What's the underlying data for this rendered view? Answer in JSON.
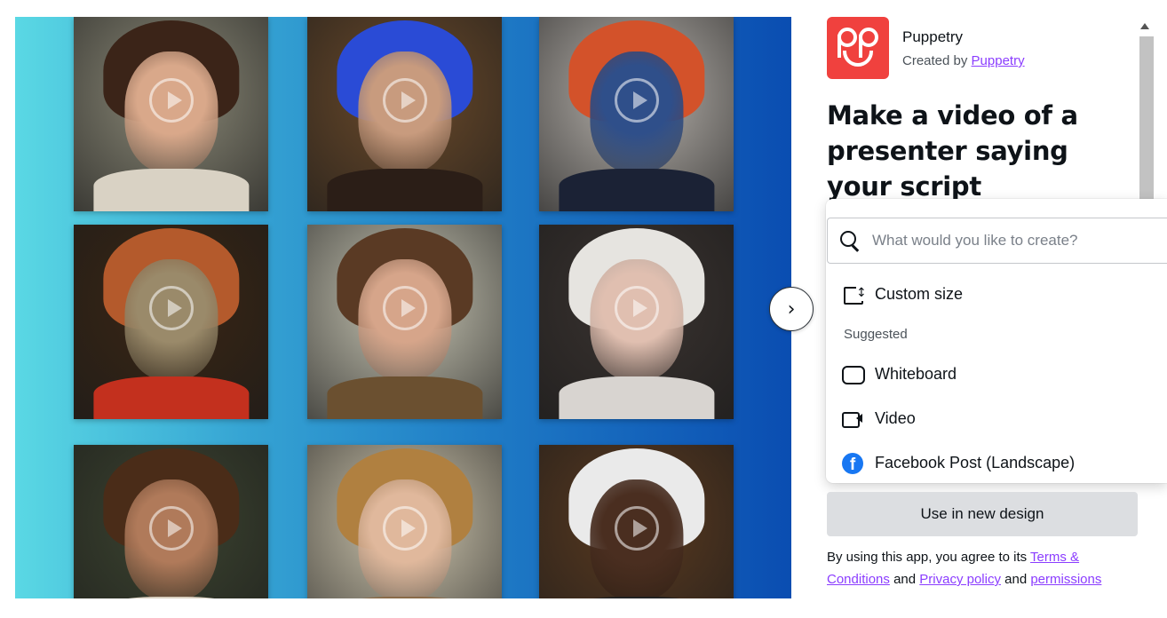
{
  "app": {
    "name": "Puppetry",
    "created_by_prefix": "Created by",
    "created_by_link": "Puppetry",
    "headline": "Make a video of a presenter saying your script",
    "logo_color": "#f0413e"
  },
  "hero": {
    "gradient_colors": [
      "#5ad8e4",
      "#0a4db1"
    ],
    "next_icon": "chevron-right-icon",
    "next_glyph": "›",
    "tiles": [
      {
        "name": "presenter-woman-brown-bob",
        "bg": "#8c8a78",
        "hair": "#3b2418",
        "skin": "#d9a88a",
        "neck": "#d9d2c4"
      },
      {
        "name": "presenter-blue-hair-cyborg",
        "bg": "#6b4a2a",
        "hair": "#2a4bd6",
        "skin": "#c89b7e",
        "neck": "#2b1e17"
      },
      {
        "name": "presenter-blue-skin-redhead",
        "bg": "#b9b4ae",
        "hair": "#d3522a",
        "skin": "#2f4f8a",
        "neck": "#1b2235"
      },
      {
        "name": "presenter-gold-robot",
        "bg": "#3a2614",
        "hair": "#b45a2c",
        "skin": "#9a8a6a",
        "neck": "#c3301e"
      },
      {
        "name": "presenter-woman-long-brown-hair",
        "bg": "#c8c6b4",
        "hair": "#5a3a24",
        "skin": "#d6a58a",
        "neck": "#6b5030"
      },
      {
        "name": "presenter-woman-white-hair",
        "bg": "#3a3330",
        "hair": "#e6e4e0",
        "skin": "#e0bfb0",
        "neck": "#d8d4d0"
      },
      {
        "name": "presenter-man-spiky-hair",
        "bg": "#3c4430",
        "hair": "#4a2c18",
        "skin": "#b07a5a",
        "neck": "#d8cfc0"
      },
      {
        "name": "presenter-woman-blonde-wavy",
        "bg": "#d0c8b0",
        "hair": "#b08040",
        "skin": "#e0b89c",
        "neck": "#8a6a48"
      },
      {
        "name": "presenter-old-man-white-hair",
        "bg": "#5a3a20",
        "hair": "#eaeaea",
        "skin": "#4a2e20",
        "neck": "#222222"
      }
    ]
  },
  "dropdown": {
    "search_placeholder": "What would you like to create?",
    "search_icon": "search-icon",
    "custom_size_label": "Custom size",
    "suggested_label": "Suggested",
    "items": [
      {
        "label": "Whiteboard",
        "icon": "whiteboard-icon"
      },
      {
        "label": "Video",
        "icon": "video-icon"
      },
      {
        "label": "Facebook Post (Landscape)",
        "icon": "facebook-icon"
      }
    ]
  },
  "actions": {
    "use_button": "Use in new design"
  },
  "legal": {
    "prefix": "By using this app, you agree to its",
    "terms": "Terms & Conditions",
    "and1": "and",
    "privacy": "Privacy policy",
    "and2": "and",
    "permissions": "permissions",
    "link_color": "#8b3dff"
  }
}
